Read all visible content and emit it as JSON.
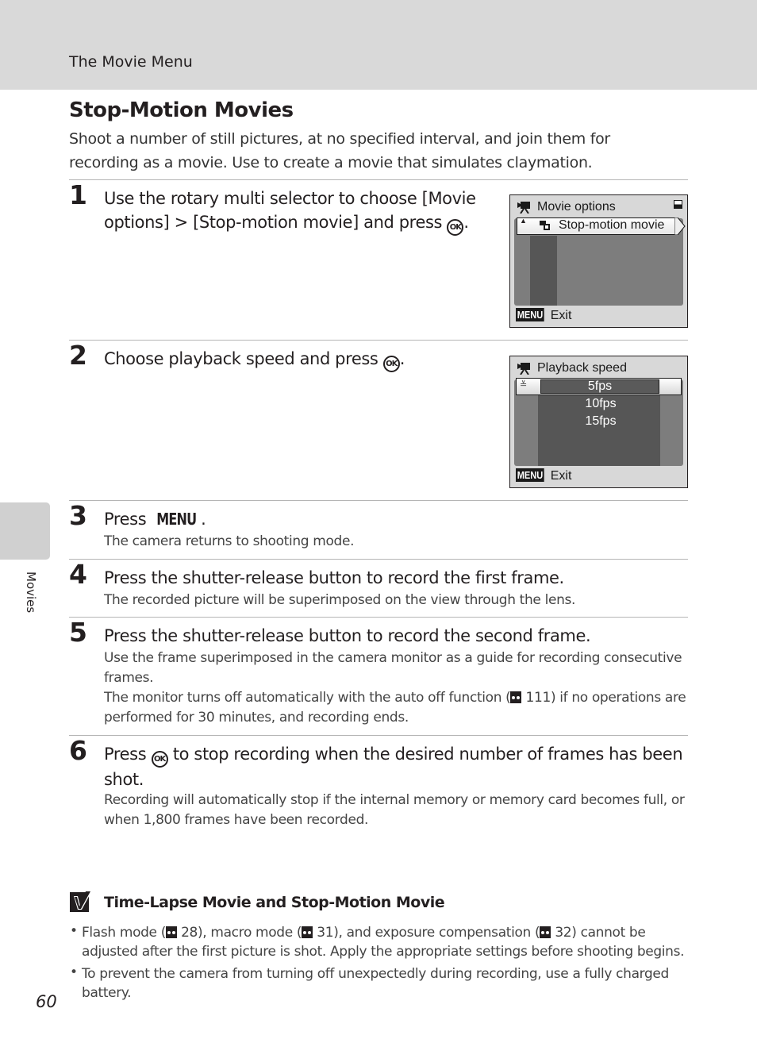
{
  "header": {
    "section": "The Movie Menu"
  },
  "title": "Stop-Motion Movies",
  "intro": "Shoot a number of still pictures, at no specified interval, and join them for recording as a movie. Use to create a movie that simulates claymation.",
  "steps": [
    {
      "num": "1",
      "head_a": "Use the rotary multi selector to choose [Movie options] > [Stop-motion movie] and press",
      "head_b": "."
    },
    {
      "num": "2",
      "head_a": "Choose playback speed and press",
      "head_b": "."
    },
    {
      "num": "3",
      "head_a": "Press",
      "head_b": ".",
      "body": "The camera returns to shooting mode."
    },
    {
      "num": "4",
      "head_a": "Press the shutter-release button to record the first frame.",
      "body": "The recorded picture will be superimposed on the view through the lens."
    },
    {
      "num": "5",
      "head_a": "Press the shutter-release button to record the second frame.",
      "body1": "Use the frame superimposed in the camera monitor as a guide for recording consecutive frames.",
      "body2_a": "The monitor turns off automatically with the auto off function (",
      "body2_ref": "111",
      "body2_b": ") if no operations are performed for 30 minutes, and recording ends."
    },
    {
      "num": "6",
      "head_a": "Press",
      "head_b": "to stop recording when the desired number of frames has been shot.",
      "body": "Recording will automatically stop if the internal memory or memory card becomes full, or when 1,800 frames have been recorded."
    }
  ],
  "glyphs": {
    "ok": "OK",
    "menu": "MENU"
  },
  "screen1": {
    "title": "Movie options",
    "item": "Stop-motion movie",
    "exit": "Exit",
    "menu": "MENU"
  },
  "screen2": {
    "title": "Playback speed",
    "options": [
      "5fps",
      "10fps",
      "15fps"
    ],
    "selected": "5fps",
    "exit": "Exit",
    "menu": "MENU"
  },
  "note": {
    "title": "Time-Lapse Movie and Stop-Motion Movie",
    "b1_a": "Flash mode (",
    "b1_r1": "28",
    "b1_b": "), macro mode (",
    "b1_r2": "31",
    "b1_c": "), and exposure compensation (",
    "b1_r3": "32",
    "b1_d": ") cannot be adjusted after the first picture is shot. Apply the appropriate settings before shooting begins.",
    "b2": "To prevent the camera from turning off unexpectedly during recording, use a fully charged battery."
  },
  "side_tab": "Movies",
  "page_number": "60"
}
